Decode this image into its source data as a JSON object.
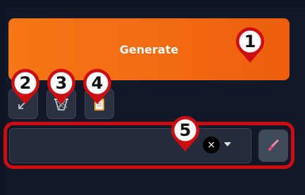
{
  "generate_button": {
    "label": "Generate"
  },
  "toolbar": {
    "buttons": [
      {
        "icon": "arrow-diagonal-icon"
      },
      {
        "icon": "basket-icon"
      },
      {
        "icon": "clipboard-icon"
      }
    ]
  },
  "markers": [
    "1",
    "2",
    "3",
    "4",
    "5"
  ],
  "dropdown": {
    "value": "",
    "clear_icon": "×"
  },
  "colors": {
    "accent": "#f26a12",
    "marker_red": "#cc0d12",
    "background": "#111827"
  }
}
